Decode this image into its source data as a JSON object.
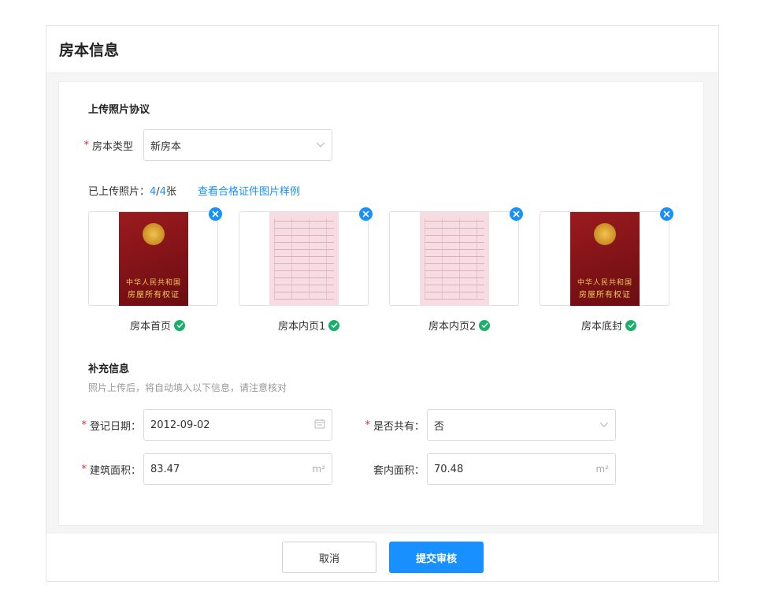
{
  "panel": {
    "title": "房本信息"
  },
  "upload_section": {
    "title": "上传照片协议",
    "type_label": "房本类型",
    "type_value": "新房本",
    "uploaded_prefix": "已上传照片：",
    "uploaded_count": "4",
    "uploaded_sep": "/",
    "uploaded_total": "4",
    "uploaded_unit": "张",
    "sample_link": "查看合格证件图片样例",
    "photos": [
      {
        "caption": "房本首页",
        "kind": "cover",
        "cover_line1": "中华人民共和国",
        "cover_line2": "房屋所有权证"
      },
      {
        "caption": "房本内页1",
        "kind": "inner"
      },
      {
        "caption": "房本内页2",
        "kind": "inner"
      },
      {
        "caption": "房本底封",
        "kind": "cover",
        "cover_line1": "中华人民共和国",
        "cover_line2": "房屋所有权证"
      }
    ]
  },
  "supplement": {
    "title": "补充信息",
    "hint": "照片上传后，将自动填入以下信息，请注意核对",
    "reg_date_label": "登记日期：",
    "reg_date_value": "2012-09-02",
    "shared_label": "是否共有：",
    "shared_value": "否",
    "build_area_label": "建筑面积：",
    "build_area_value": "83.47",
    "inner_area_label": "套内面积：",
    "inner_area_value": "70.48",
    "unit": "m²"
  },
  "footer": {
    "cancel_label": "取消",
    "submit_label": "提交审核"
  },
  "colors": {
    "accent": "#1890ff",
    "required": "#f5222d",
    "success": "#1ab06b"
  },
  "icons": {
    "close": "close-icon",
    "check": "check-circle-icon",
    "chevron": "chevron-down-icon",
    "calendar": "calendar-icon"
  }
}
